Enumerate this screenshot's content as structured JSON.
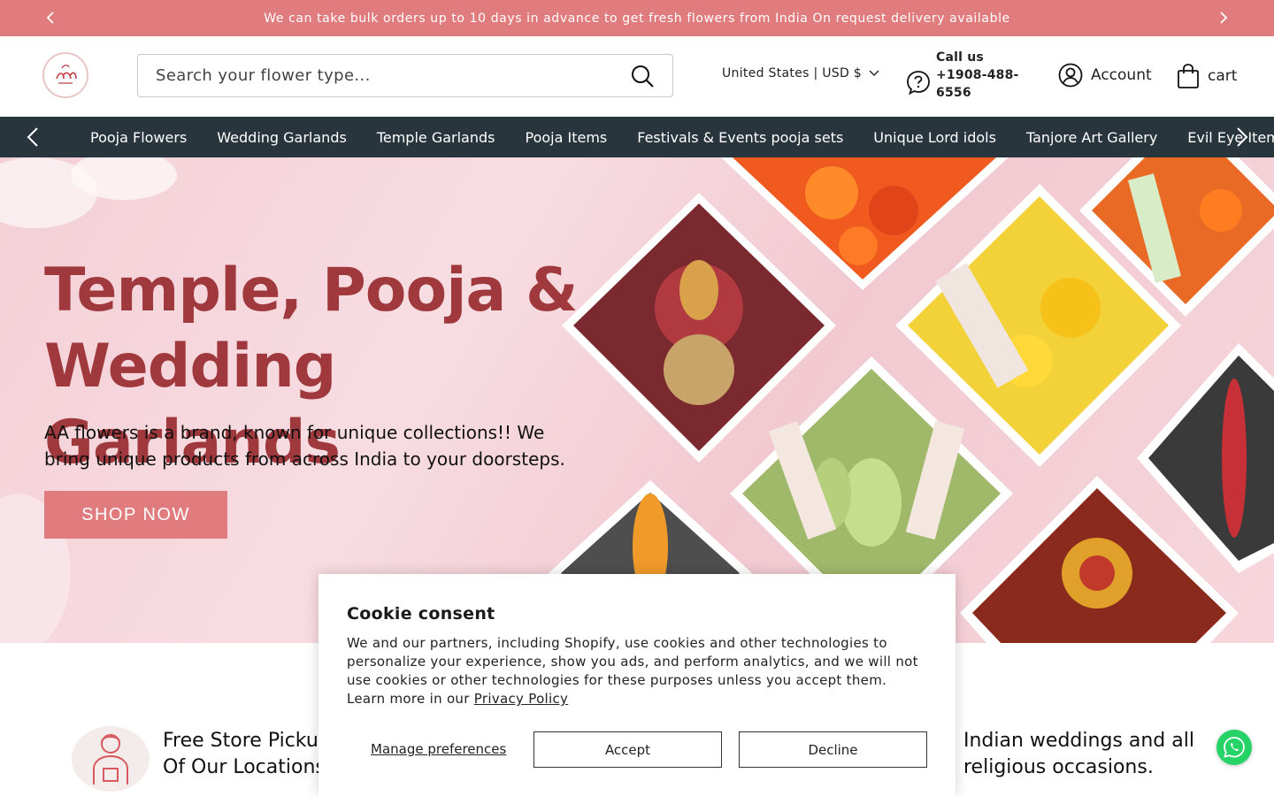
{
  "announcement": {
    "message": "We can take bulk orders up to 10 days in advance to get fresh flowers from India On request delivery available"
  },
  "header": {
    "search_placeholder": "Search your flower type...",
    "currency": "United States | USD $",
    "call_label": "Call us",
    "phone": "+1908-488-6556",
    "account_label": "Account",
    "cart_label": "cart"
  },
  "nav": {
    "items": [
      {
        "label": "Pooja Flowers"
      },
      {
        "label": "Wedding Garlands"
      },
      {
        "label": "Temple Garlands"
      },
      {
        "label": "Pooja Items"
      },
      {
        "label": "Festivals & Events pooja sets"
      },
      {
        "label": "Unique Lord idols"
      },
      {
        "label": "Tanjore Art Gallery"
      },
      {
        "label": "Evil Eye Items"
      }
    ]
  },
  "hero": {
    "title": "Temple, Pooja & Wedding Garlands",
    "subtitle": "AA flowers is a brand, known for unique collections!! We bring unique products from across India to your doorsteps.",
    "button_label": "SHOP NOW"
  },
  "features": {
    "left_text": "Free Store Pickup Of Our Locations",
    "right_text": "Indian weddings and all religious occasions."
  },
  "cookie": {
    "title": "Cookie consent",
    "body": "We and our partners, including Shopify, use cookies and other technologies to personalize your experience, show you ads, and perform analytics, and we will not use cookies or other technologies for these purposes unless you accept them. Learn more in our",
    "privacy_link": "Privacy Policy",
    "manage_label": "Manage preferences",
    "accept_label": "Accept",
    "decline_label": "Decline"
  },
  "colors": {
    "brand_pink": "#e07b7e",
    "hero_title": "#a0393d",
    "nav_bg": "#29353c",
    "whatsapp": "#25d366"
  }
}
